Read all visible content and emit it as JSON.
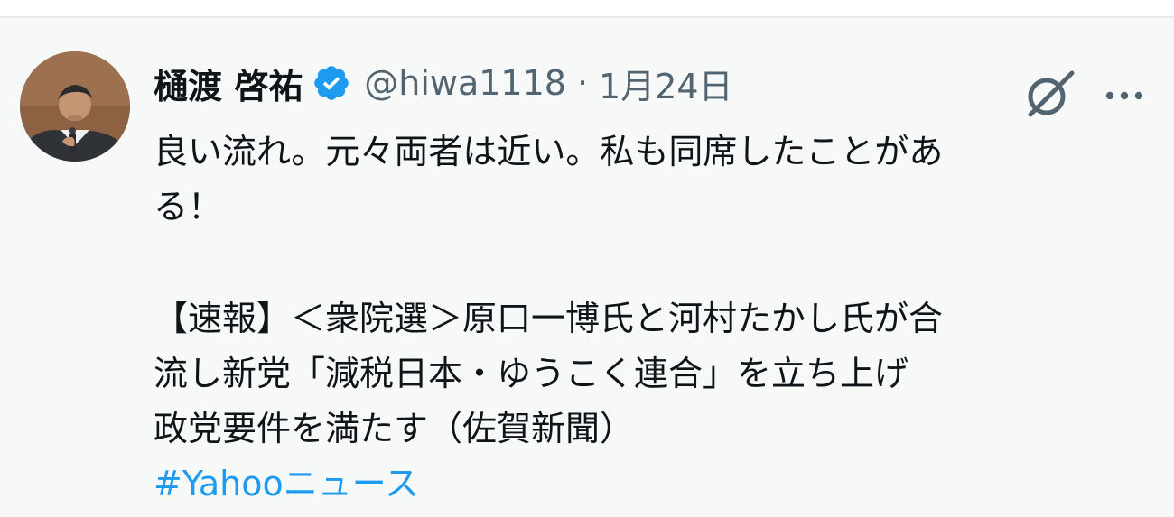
{
  "tweet": {
    "author": {
      "display_name": "樋渡 啓祐",
      "handle": "@hiwa1118",
      "verified_icon": "verified-badge-icon",
      "avatar_icon": "avatar-photo"
    },
    "meta": {
      "separator": "·",
      "date": "1月24日"
    },
    "icons": {
      "grok": "grok-icon",
      "more": "more-icon"
    },
    "body": {
      "line1": "良い流れ。元々両者は近い。私も同席したことがあ",
      "line2": "る！",
      "line3": "【速報】＜衆院選＞原口一博氏と河村たかし氏が合",
      "line4": "流し新党「減税日本・ゆうこく連合」を立ち上げ",
      "line5": "政党要件を満たす（佐賀新聞）",
      "hashtag": "#Yahooニュース"
    },
    "colors": {
      "accent": "#1d9bf0",
      "text": "#0f1419",
      "secondary": "#536471",
      "background": "#f7f9f9"
    }
  }
}
